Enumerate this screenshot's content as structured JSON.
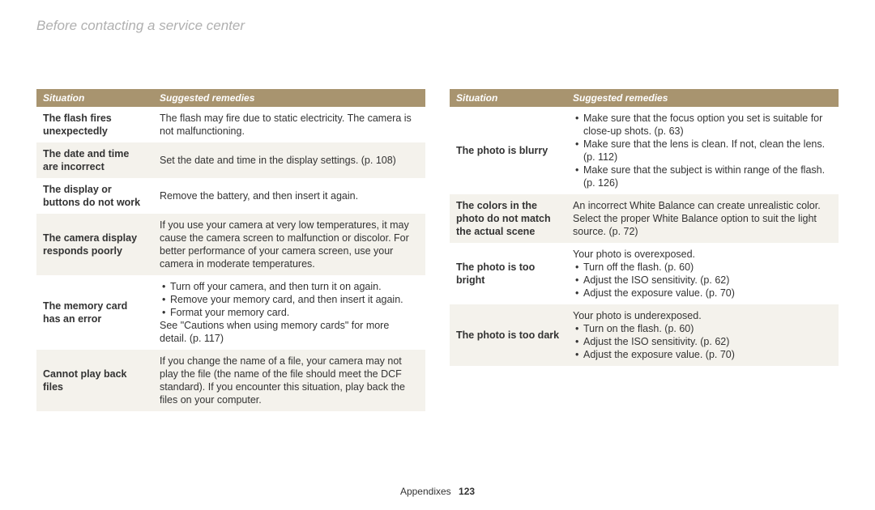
{
  "title": "Before contacting a service center",
  "headers": {
    "situation": "Situation",
    "remedies": "Suggested remedies"
  },
  "footer": {
    "section": "Appendixes",
    "page": "123"
  },
  "left": [
    {
      "situation": "The flash fires unexpectedly",
      "remedy_text": "The flash may fire due to static electricity. The camera is not malfunctioning."
    },
    {
      "situation": "The date and time are incorrect",
      "remedy_text": "Set the date and time in the display settings. (p. 108)"
    },
    {
      "situation": "The display or buttons do not work",
      "remedy_text": "Remove the battery, and then insert it again."
    },
    {
      "situation": "The camera display responds poorly",
      "remedy_text": "If you use your camera at very low temperatures, it may cause the camera screen to malfunction or discolor. For better performance of your camera screen, use your camera in moderate temperatures."
    },
    {
      "situation": "The memory card has an error",
      "remedy_lead": "",
      "remedy_bullets": [
        "Turn off your camera, and then turn it on again.",
        "Remove your memory card, and then insert it again.",
        "Format your memory card."
      ],
      "remedy_tail": "See \"Cautions when using memory cards\" for more detail. (p. 117)"
    },
    {
      "situation": "Cannot play back files",
      "remedy_text": "If you change the name of a file, your camera may not play the file (the name of the file should meet the DCF standard). If you encounter this situation, play back the files on your computer."
    }
  ],
  "right": [
    {
      "situation": "The photo is blurry",
      "remedy_bullets": [
        "Make sure that the focus option you set is suitable for close-up shots. (p. 63)",
        "Make sure that the lens is clean. If not, clean the lens. (p. 112)",
        "Make sure that the subject is within range of the flash. (p. 126)"
      ]
    },
    {
      "situation": "The colors in the photo do not match the actual scene",
      "remedy_text": "An incorrect White Balance can create unrealistic color. Select the proper White Balance option to suit the light source. (p. 72)"
    },
    {
      "situation": "The photo is too bright",
      "remedy_lead": "Your photo is overexposed.",
      "remedy_bullets": [
        "Turn off the flash. (p. 60)",
        "Adjust the ISO sensitivity. (p. 62)",
        "Adjust the exposure value. (p. 70)"
      ]
    },
    {
      "situation": "The photo is too dark",
      "remedy_lead": "Your photo is underexposed.",
      "remedy_bullets": [
        "Turn on the flash. (p. 60)",
        "Adjust the ISO sensitivity. (p. 62)",
        "Adjust the exposure value. (p. 70)"
      ]
    }
  ]
}
